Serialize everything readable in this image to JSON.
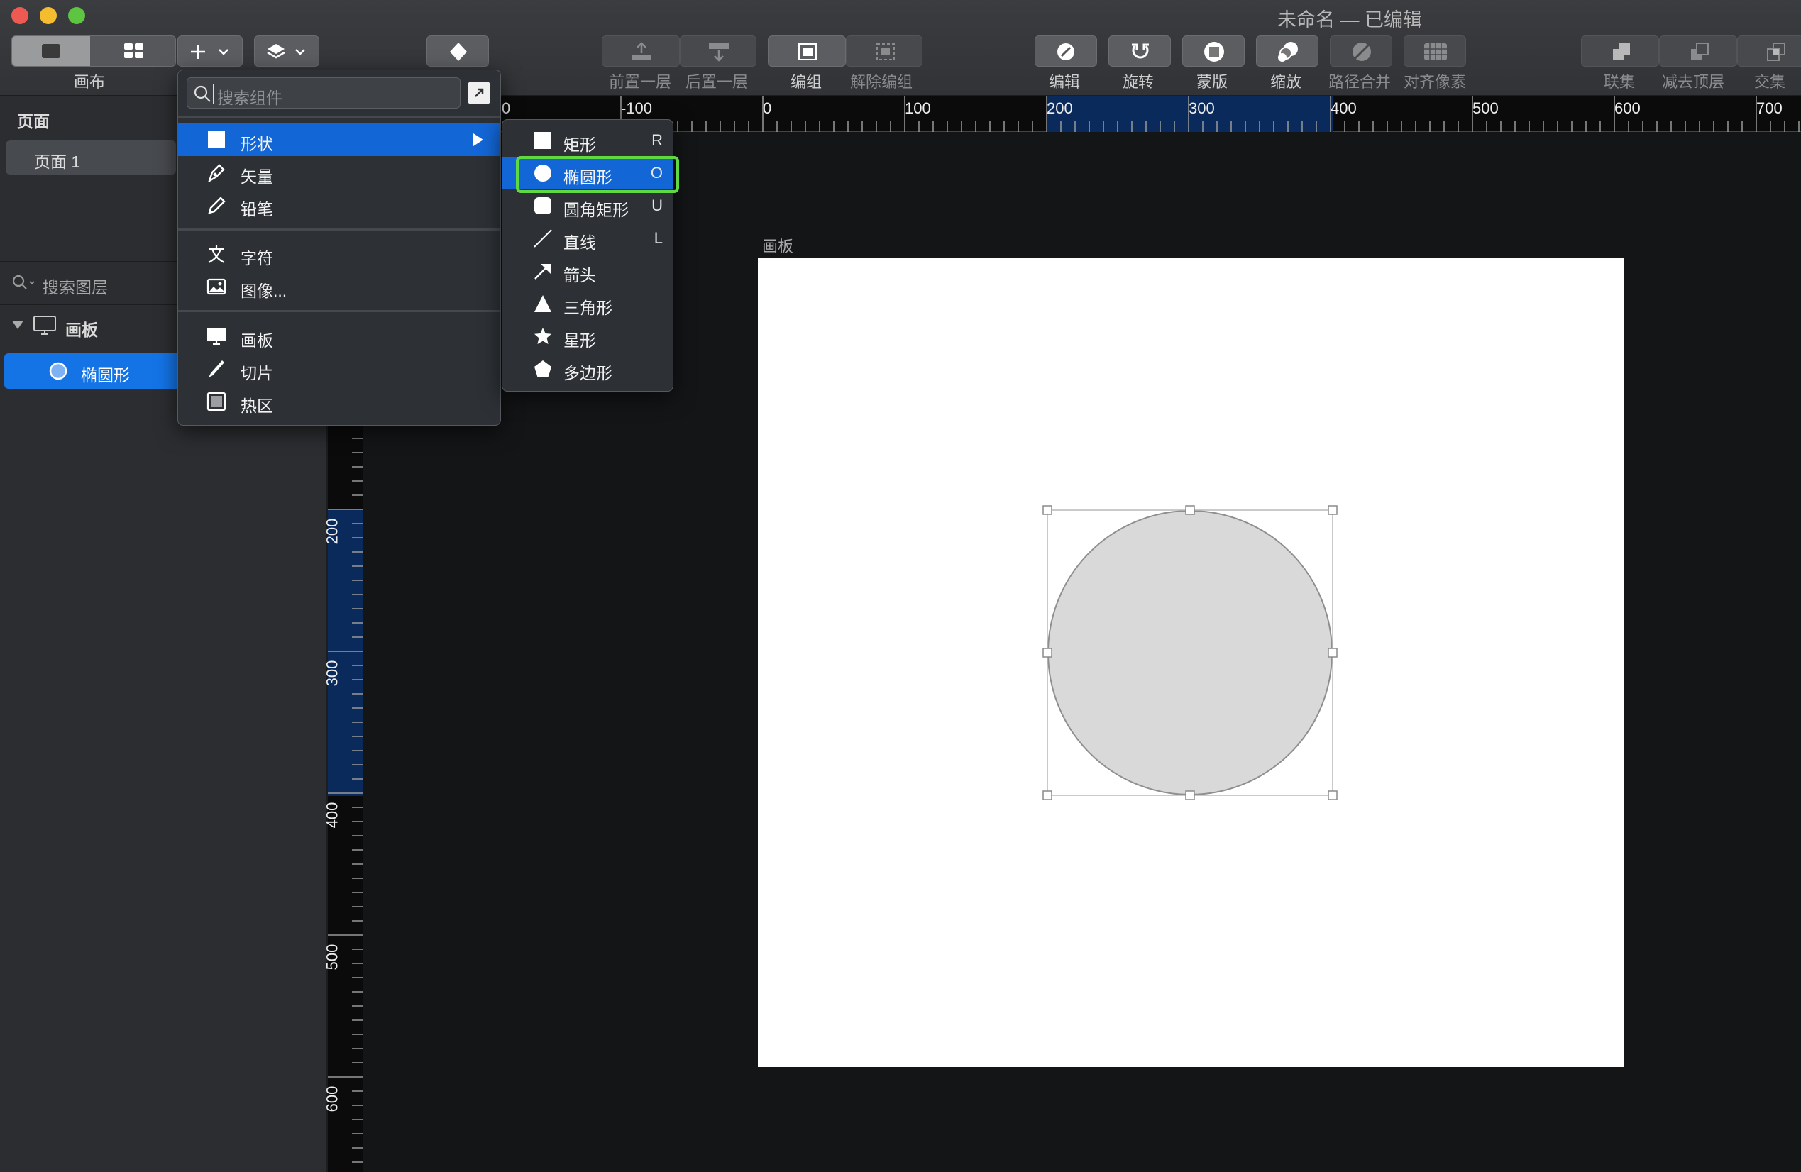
{
  "window": {
    "title": "未命名 — 已编辑"
  },
  "toolbar": {
    "canvas_label": "画布",
    "forward_label": "前置一层",
    "backward_label": "后置一层",
    "group_label": "编组",
    "ungroup_label": "解除编组",
    "edit_label": "编辑",
    "rotate_label": "旋转",
    "mask_label": "蒙版",
    "scale_label": "缩放",
    "flatten_label": "路径合并",
    "pixel_align_label": "对齐像素",
    "union_label": "联集",
    "subtract_label": "减去顶层",
    "intersect_label": "交集"
  },
  "sidebar": {
    "pages_title": "页面",
    "pages": [
      "页面 1"
    ],
    "search_placeholder": "搜索图层",
    "layers": [
      {
        "label": "画板"
      },
      {
        "label": "椭圆形"
      }
    ]
  },
  "insert_menu": {
    "search_placeholder": "搜索组件",
    "items": [
      {
        "label": "形状",
        "icon": "square-icon"
      },
      {
        "label": "矢量",
        "icon": "pen-icon"
      },
      {
        "label": "铅笔",
        "icon": "pencil-icon"
      },
      {
        "label": "字符",
        "icon": "text-icon"
      },
      {
        "label": "图像...",
        "icon": "image-icon"
      },
      {
        "label": "画板",
        "icon": "artboard-icon"
      },
      {
        "label": "切片",
        "icon": "slice-icon"
      },
      {
        "label": "热区",
        "icon": "hotspot-icon"
      }
    ]
  },
  "shape_submenu": {
    "items": [
      {
        "label": "矩形",
        "key": "R"
      },
      {
        "label": "椭圆形",
        "key": "O"
      },
      {
        "label": "圆角矩形",
        "key": "U"
      },
      {
        "label": "直线",
        "key": "L"
      },
      {
        "label": "箭头",
        "key": ""
      },
      {
        "label": "三角形",
        "key": ""
      },
      {
        "label": "星形",
        "key": ""
      },
      {
        "label": "多边形",
        "key": ""
      }
    ]
  },
  "ruler": {
    "h_labels": [
      "0",
      "-100",
      "0",
      "100",
      "200",
      "300",
      "400",
      "500",
      "600",
      "700"
    ],
    "v_labels": [
      "200",
      "300",
      "400",
      "500",
      "600"
    ]
  },
  "canvas": {
    "artboard_label": "画板"
  },
  "colors": {
    "accent": "#1366d6",
    "highlight": "#5fd93f",
    "shape_fill": "#d9d9d9"
  }
}
